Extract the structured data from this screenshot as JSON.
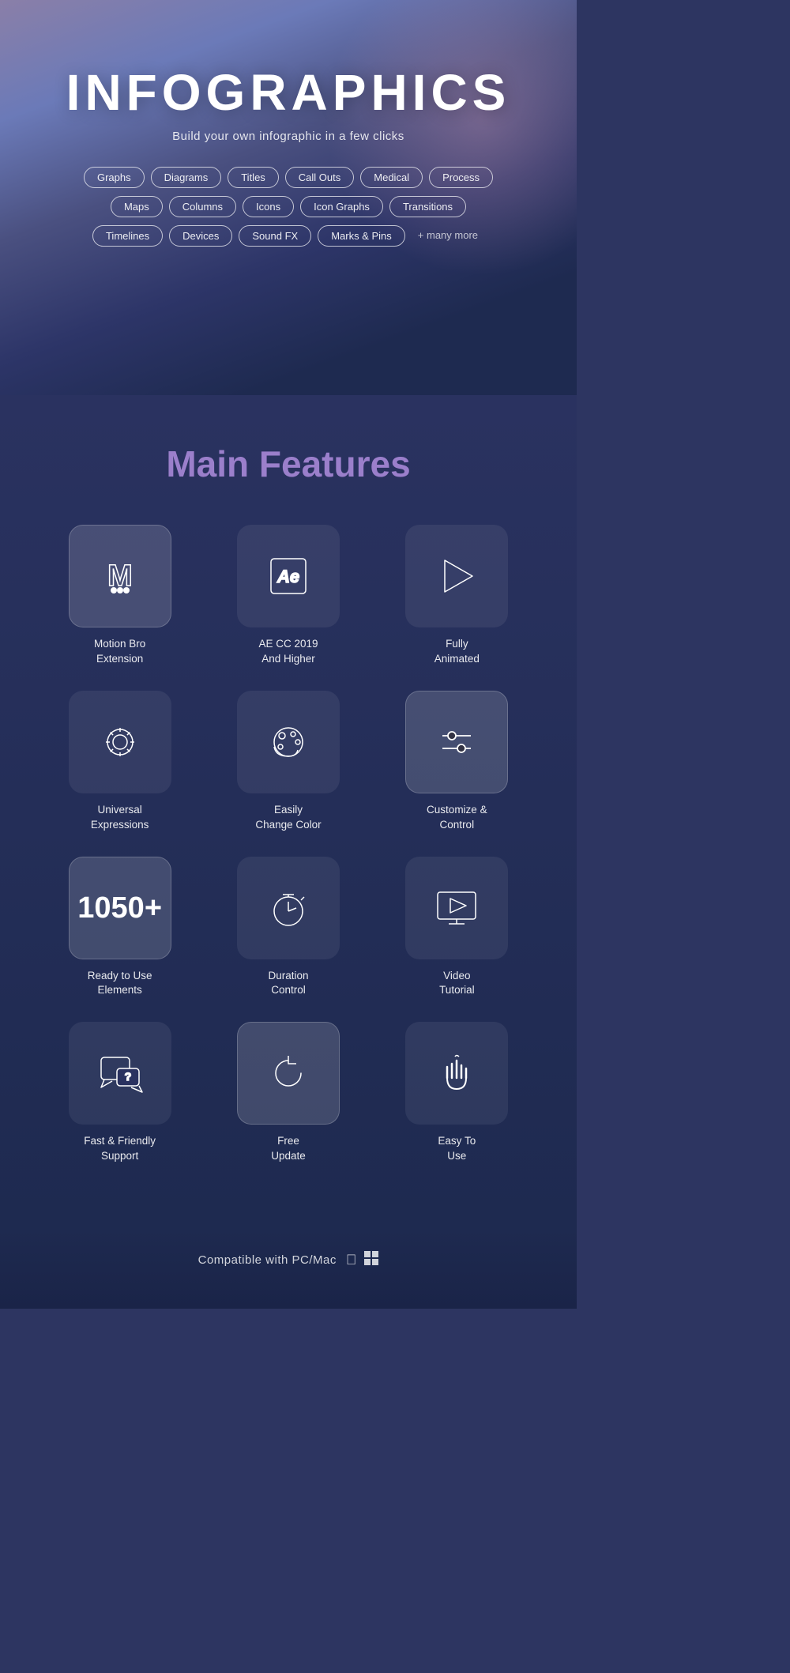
{
  "hero": {
    "title": "INFOGRAPHICS",
    "subtitle": "Build your own infographic in a few clicks",
    "tags_row1": [
      "Graphs",
      "Diagrams",
      "Titles",
      "Call Outs",
      "Medical",
      "Process"
    ],
    "tags_row2": [
      "Maps",
      "Columns",
      "Icons",
      "Icon Graphs",
      "Transitions"
    ],
    "tags_row3": [
      "Timelines",
      "Devices",
      "Sound FX",
      "Marks & Pins"
    ],
    "tags_more": "+ many more"
  },
  "features_section": {
    "title_white": "Main",
    "title_purple": "Features",
    "items": [
      {
        "id": "motion-bro",
        "label": "Motion Bro\nExtension",
        "highlight": true,
        "icon": "motion-bro"
      },
      {
        "id": "ae-cc",
        "label": "AE CC 2019\nAnd Higher",
        "highlight": false,
        "icon": "ae"
      },
      {
        "id": "fully-animated",
        "label": "Fully\nAnimated",
        "highlight": false,
        "icon": "play"
      },
      {
        "id": "universal",
        "label": "Universal\nExpressions",
        "highlight": false,
        "icon": "gear"
      },
      {
        "id": "change-color",
        "label": "Easily\nChange Color",
        "highlight": false,
        "icon": "palette"
      },
      {
        "id": "customize",
        "label": "Customize &\nControl",
        "highlight": true,
        "icon": "sliders"
      },
      {
        "id": "elements",
        "label": "Ready to Use\nElements",
        "highlight": true,
        "icon": "number",
        "number": "1050+"
      },
      {
        "id": "duration",
        "label": "Duration\nControl",
        "highlight": false,
        "icon": "stopwatch"
      },
      {
        "id": "video-tutorial",
        "label": "Video\nTutorial",
        "highlight": false,
        "icon": "monitor-play"
      },
      {
        "id": "support",
        "label": "Fast & Friendly\nSupport",
        "highlight": false,
        "icon": "chat-question"
      },
      {
        "id": "free-update",
        "label": "Free\nUpdate",
        "highlight": true,
        "icon": "refresh"
      },
      {
        "id": "easy-to-use",
        "label": "Easy To\nUse",
        "highlight": false,
        "icon": "hand-wave"
      }
    ]
  },
  "compat": {
    "text": "Compatible with PC/Mac"
  }
}
